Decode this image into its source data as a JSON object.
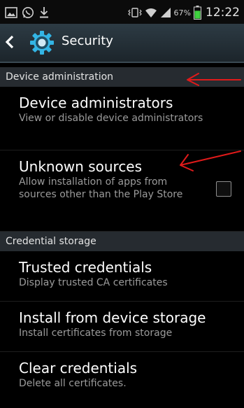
{
  "status_bar": {
    "icons": [
      "gallery-icon",
      "whatsapp-icon",
      "download-icon",
      "vibrate-icon",
      "wifi-icon",
      "signal-icon",
      "battery-icon"
    ],
    "battery_pct": "67%",
    "time": "12:22"
  },
  "action_bar": {
    "title": "Security",
    "icons": [
      "back-chevron-icon",
      "settings-gear-icon"
    ]
  },
  "sections": [
    {
      "header": "Device administration",
      "items": [
        {
          "title": "Device administrators",
          "summary": "View or disable device administrators"
        },
        {
          "title": "Unknown sources",
          "summary": "Allow installation of apps from sources other than the Play Store",
          "checkbox": {
            "checked": false
          }
        }
      ]
    },
    {
      "header": "Credential storage",
      "items": [
        {
          "title": "Trusted credentials",
          "summary": "Display trusted CA certificates"
        },
        {
          "title": "Install from device storage",
          "summary": "Install certificates from storage"
        },
        {
          "title": "Clear credentials",
          "summary": "Delete all certificates."
        }
      ]
    }
  ],
  "annotations": {
    "arrow_color": "#e01a1a"
  },
  "colors": {
    "accent_blue": "#33b5e5",
    "battery_green": "#3fd13f",
    "summary_grey": "#9b9b9b",
    "header_bg": "#262b30"
  }
}
